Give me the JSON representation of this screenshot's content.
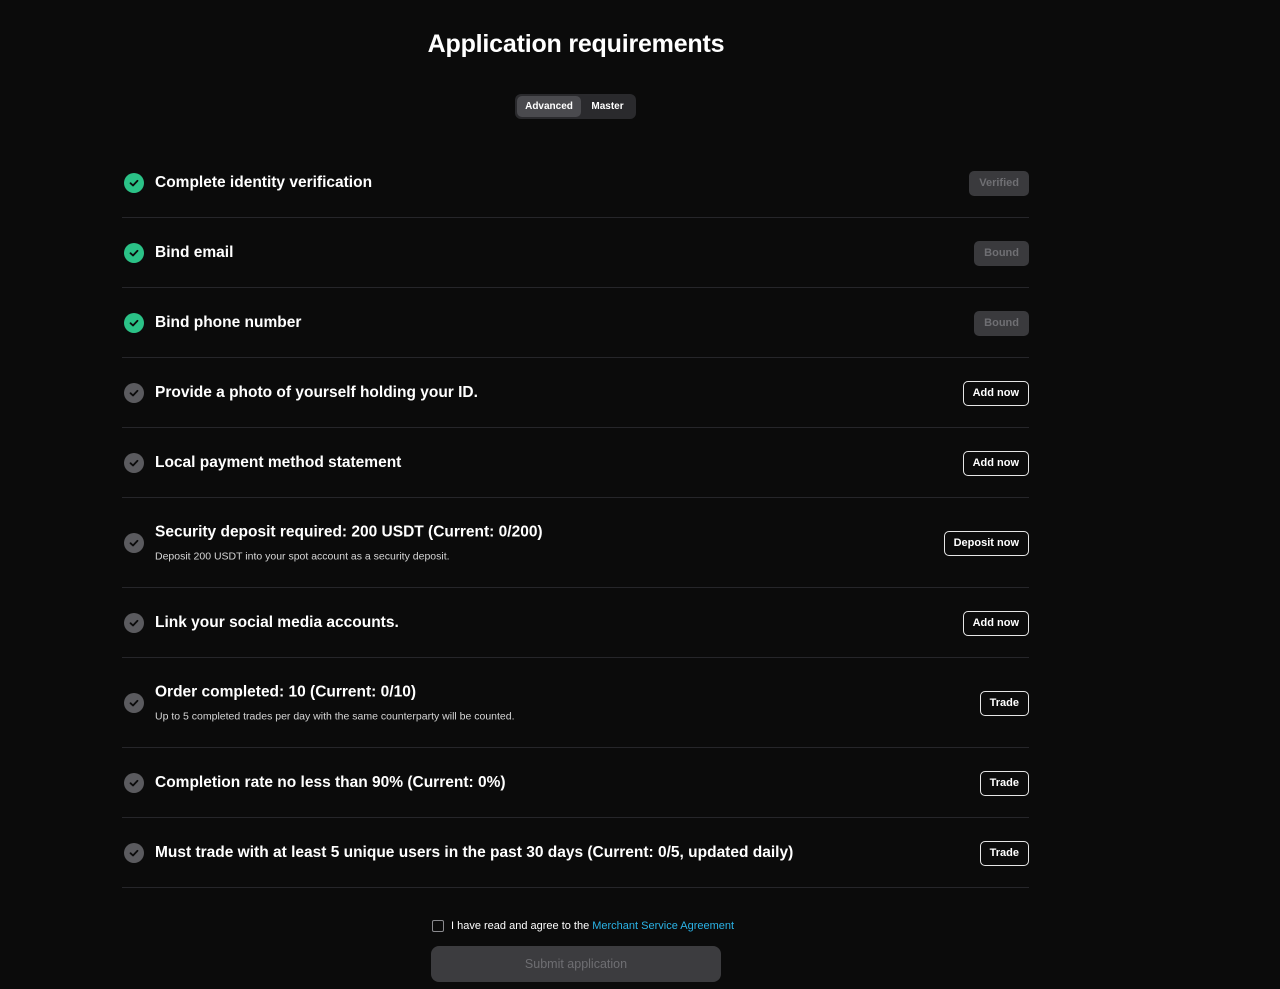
{
  "page": {
    "title": "Application requirements"
  },
  "tabs": {
    "advanced": "Advanced",
    "master": "Master",
    "selected": "Advanced"
  },
  "requirements": [
    {
      "label": "Complete identity verification",
      "status": "done",
      "action": "Verified",
      "action_state": "disabled"
    },
    {
      "label": "Bind email",
      "status": "done",
      "action": "Bound",
      "action_state": "disabled"
    },
    {
      "label": "Bind phone number",
      "status": "done",
      "action": "Bound",
      "action_state": "disabled"
    },
    {
      "label": "Provide a photo of yourself holding your ID.",
      "status": "pending",
      "action": "Add now",
      "action_state": "enabled"
    },
    {
      "label": "Local payment method statement",
      "status": "pending",
      "action": "Add now",
      "action_state": "enabled"
    },
    {
      "label": "Security deposit required: 200 USDT (Current: 0/200)",
      "sub": "Deposit 200 USDT into your spot account as a security deposit.",
      "status": "pending",
      "action": "Deposit now",
      "action_state": "enabled"
    },
    {
      "label": "Link your social media accounts.",
      "status": "pending",
      "action": "Add now",
      "action_state": "enabled"
    },
    {
      "label": "Order completed: 10 (Current: 0/10)",
      "sub": "Up to 5 completed trades per day with the same counterparty will be counted.",
      "status": "pending",
      "action": "Trade",
      "action_state": "enabled"
    },
    {
      "label": "Completion rate no less than 90% (Current: 0%)",
      "status": "pending",
      "action": "Trade",
      "action_state": "enabled"
    },
    {
      "label": "Must trade with at least 5 unique users in the past 30 days (Current: 0/5, updated daily)",
      "status": "pending",
      "action": "Trade",
      "action_state": "enabled"
    }
  ],
  "agreement": {
    "text": "I have read and agree to the",
    "link": "Merchant Service Agreement",
    "checked": false
  },
  "submit": {
    "label": "Submit application",
    "state": "disabled"
  },
  "colors": {
    "background": "#0b0b0b",
    "check_done": "#2bc287",
    "check_pending": "#5b5b5f",
    "link": "#2bb3e6"
  },
  "icons": {
    "done": "check-circle-icon",
    "pending": "check-circle-icon"
  }
}
